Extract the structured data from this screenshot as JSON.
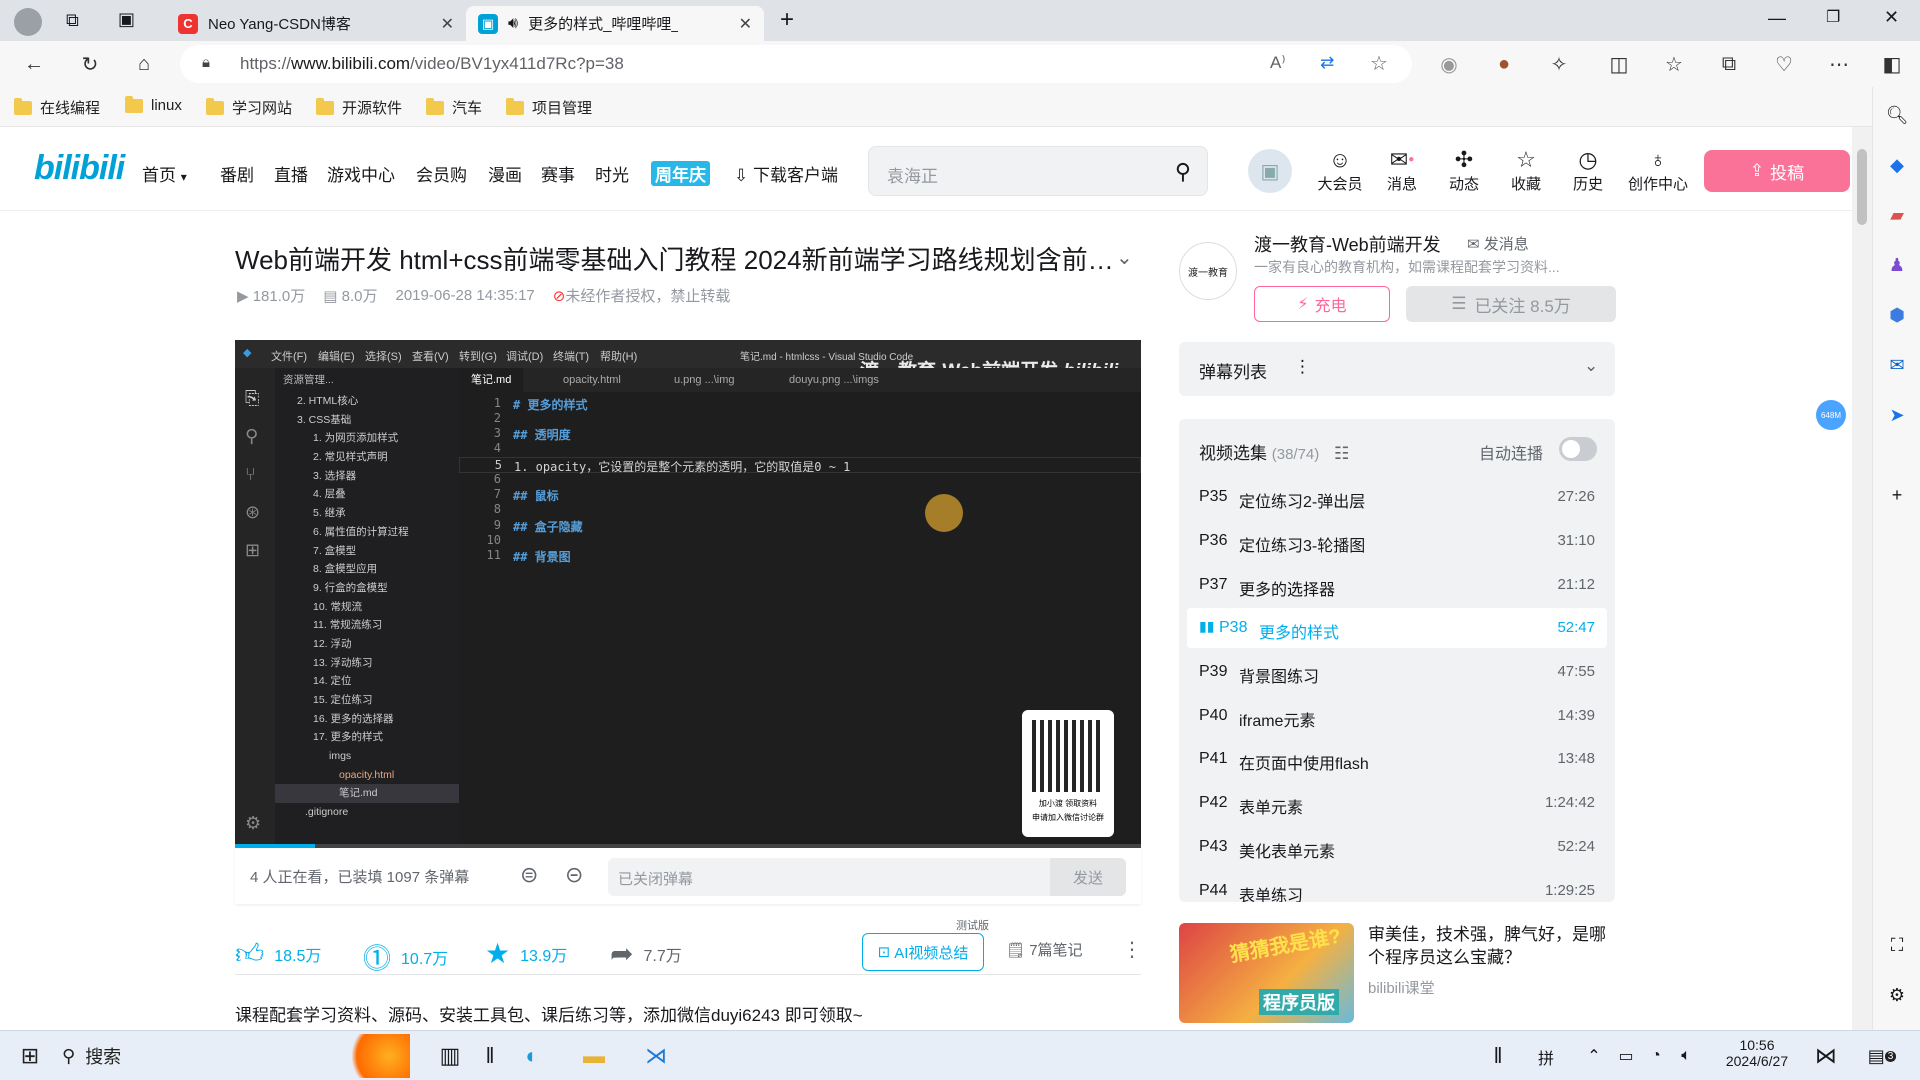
{
  "browser": {
    "tabs": [
      {
        "title": "Neo Yang-CSDN博客",
        "favicon": "C"
      },
      {
        "title": "更多的样式_哔哩哔哩_bilibili"
      }
    ],
    "url_prefix": "https://",
    "url_host": "www.bilibili.com",
    "url_path": "/video/BV1yx411d7Rc?p=38",
    "bookmarks": [
      "在线编程",
      "linux",
      "学习网站",
      "开源软件",
      "汽车",
      "项目管理"
    ]
  },
  "header": {
    "logo": "bilibili",
    "nav": [
      "首页",
      "番剧",
      "直播",
      "游戏中心",
      "会员购",
      "漫画",
      "赛事",
      "时光",
      "周年庆",
      "下载客户端"
    ],
    "search_placeholder": "袁海正",
    "icons": [
      {
        "label": "大会员",
        "icon": "vip-icon"
      },
      {
        "label": "消息",
        "icon": "message-icon"
      },
      {
        "label": "动态",
        "icon": "dynamic-icon"
      },
      {
        "label": "收藏",
        "icon": "star-icon"
      },
      {
        "label": "历史",
        "icon": "history-icon"
      },
      {
        "label": "创作中心",
        "icon": "creator-icon"
      }
    ],
    "upload": "投稿"
  },
  "video": {
    "title": "Web前端开发 html+css前端零基础入门教程 2024新前端学习路线规划含前…",
    "views": "181.0万",
    "danmaku_count": "8.0万",
    "date": "2019-06-28 14:35:17",
    "copyright": "未经作者授权，禁止转载",
    "watermark": "渡一教育-Web前端开发",
    "watching": "4 人正在看，已装填 1097 条弹幕",
    "danmaku_placeholder": "已关闭弹幕",
    "send": "发送",
    "likes": "18.5万",
    "coins": "10.7万",
    "favorites": "13.9万",
    "shares": "7.7万",
    "ai_summary": "AI视频总结",
    "ai_tag": "测试版",
    "notes": "7篇笔记",
    "description": "课程配套学习资料、源码、安装工具包、课后练习等，添加微信duyi6243 即可领取~"
  },
  "vscode": {
    "menu": [
      "文件(F)",
      "编辑(E)",
      "选择(S)",
      "查看(V)",
      "转到(G)",
      "调试(D)",
      "终端(T)",
      "帮助(H)"
    ],
    "window_title": "笔记.md - htmlcss - Visual Studio Code",
    "explorer_title": "资源管理...",
    "tabs": [
      "笔记.md",
      "opacity.html",
      "u.png ...\\img",
      "douyu.png ...\\imgs"
    ],
    "tree": [
      "2. HTML核心",
      "3. CSS基础",
      "1. 为网页添加样式",
      "2. 常见样式声明",
      "3. 选择器",
      "4. 层叠",
      "5. 继承",
      "6. 属性值的计算过程",
      "7. 盒模型",
      "8. 盒模型应用",
      "9. 行盒的盒模型",
      "10. 常规流",
      "11. 常规流练习",
      "12. 浮动",
      "13. 浮动练习",
      "14. 定位",
      "15. 定位练习",
      "16. 更多的选择器",
      "17. 更多的样式",
      "imgs",
      "opacity.html",
      "笔记.md",
      ".gitignore"
    ],
    "code": [
      {
        "ln": "1",
        "text": "# 更多的样式",
        "h": true
      },
      {
        "ln": "2",
        "text": ""
      },
      {
        "ln": "3",
        "text": "## 透明度",
        "h": true
      },
      {
        "ln": "4",
        "text": ""
      },
      {
        "ln": "5",
        "text": "1. opacity，它设置的是整个元素的透明，它的取值是0 ~ 1"
      },
      {
        "ln": "6",
        "text": ""
      },
      {
        "ln": "7",
        "text": "## 鼠标",
        "h": true
      },
      {
        "ln": "8",
        "text": ""
      },
      {
        "ln": "9",
        "text": "## 盒子隐藏",
        "h": true
      },
      {
        "ln": "10",
        "text": ""
      },
      {
        "ln": "11",
        "text": "## 背景图",
        "h": true
      }
    ],
    "qr_caption1": "加小渡 领取资料",
    "qr_caption2": "申请加入微信讨论群"
  },
  "uploader": {
    "name": "渡一教育-Web前端开发",
    "message": "发消息",
    "desc": "一家有良心的教育机构，如需课程配套学习资料...",
    "charge": "充电",
    "followed": "已关注 8.5万",
    "avatar_text": "渡一教育"
  },
  "danmaku_list": "弹幕列表",
  "episodes": {
    "title": "视频选集",
    "count": "(38/74)",
    "autoplay": "自动连播",
    "items": [
      {
        "p": "P35",
        "title": "定位练习2-弹出层",
        "dur": "27:26"
      },
      {
        "p": "P36",
        "title": "定位练习3-轮播图",
        "dur": "31:10"
      },
      {
        "p": "P37",
        "title": "更多的选择器",
        "dur": "21:12"
      },
      {
        "p": "P38",
        "title": "更多的样式",
        "dur": "52:47",
        "active": true
      },
      {
        "p": "P39",
        "title": "背景图练习",
        "dur": "47:55"
      },
      {
        "p": "P40",
        "title": "iframe元素",
        "dur": "14:39"
      },
      {
        "p": "P41",
        "title": "在页面中使用flash",
        "dur": "13:48"
      },
      {
        "p": "P42",
        "title": "表单元素",
        "dur": "1:24:42"
      },
      {
        "p": "P43",
        "title": "美化表单元素",
        "dur": "52:24"
      },
      {
        "p": "P44",
        "title": "表单练习",
        "dur": "1:29:25"
      }
    ]
  },
  "recommend": {
    "title": "审美佳，技术强，脾气好，是哪个程序员这么宝藏？",
    "up": "bilibili课堂",
    "thumb_text1": "猜猜我是谁?",
    "thumb_text2": "程序员版"
  },
  "taskbar": {
    "search": "搜索",
    "time": "10:56",
    "date": "2024/6/27",
    "ime": "拼",
    "notif": "3"
  },
  "colors": {
    "accent": "#00aeec",
    "pink": "#fb7299"
  }
}
